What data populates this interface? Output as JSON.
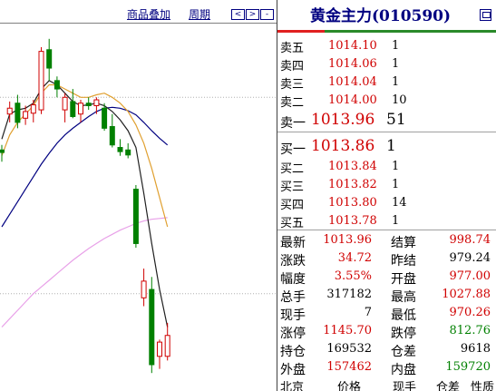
{
  "chart_toolbar": {
    "overlay_label": "商品叠加",
    "period_label": "周期",
    "btn_left": "<",
    "btn_right": ">",
    "btn_zoom": "-"
  },
  "quote": {
    "title": "黄金主力(010590)",
    "asks": [
      {
        "label": "卖五",
        "price": "1014.10",
        "vol": "1"
      },
      {
        "label": "卖四",
        "price": "1014.06",
        "vol": "1"
      },
      {
        "label": "卖三",
        "price": "1014.04",
        "vol": "1"
      },
      {
        "label": "卖二",
        "price": "1014.00",
        "vol": "10"
      },
      {
        "label": "卖一",
        "price": "1013.96",
        "vol": "51"
      }
    ],
    "bids": [
      {
        "label": "买一",
        "price": "1013.86",
        "vol": "1"
      },
      {
        "label": "买二",
        "price": "1013.84",
        "vol": "1"
      },
      {
        "label": "买三",
        "price": "1013.82",
        "vol": "1"
      },
      {
        "label": "买四",
        "price": "1013.80",
        "vol": "14"
      },
      {
        "label": "买五",
        "price": "1013.78",
        "vol": "1"
      }
    ],
    "stats": [
      {
        "l1": "最新",
        "v1": "1013.96",
        "c1": "red",
        "l2": "结算",
        "v2": "998.74",
        "c2": "red"
      },
      {
        "l1": "涨跌",
        "v1": "34.72",
        "c1": "red",
        "l2": "昨结",
        "v2": "979.24",
        "c2": "black"
      },
      {
        "l1": "幅度",
        "v1": "3.55%",
        "c1": "red",
        "l2": "开盘",
        "v2": "977.00",
        "c2": "red"
      },
      {
        "l1": "总手",
        "v1": "317182",
        "c1": "black",
        "l2": "最高",
        "v2": "1027.88",
        "c2": "red"
      },
      {
        "l1": "现手",
        "v1": "7",
        "c1": "black",
        "l2": "最低",
        "v2": "970.26",
        "c2": "red"
      },
      {
        "l1": "涨停",
        "v1": "1145.70",
        "c1": "red",
        "l2": "跌停",
        "v2": "812.76",
        "c2": "green"
      },
      {
        "l1": "持仓",
        "v1": "169532",
        "c1": "black",
        "l2": "仓差",
        "v2": "9618",
        "c2": "black"
      },
      {
        "l1": "外盘",
        "v1": "157462",
        "c1": "red",
        "l2": "内盘",
        "v2": "159720",
        "c2": "green"
      }
    ],
    "footer": {
      "col1": "北京",
      "col2": "价格",
      "col3": "现手",
      "col4": "仓差",
      "col5": "性质"
    }
  },
  "colors": {
    "up": "#d00000",
    "down": "#008000",
    "title": "#000080"
  },
  "chart_data": {
    "type": "candlestick",
    "candles": [
      {
        "o": 1.2,
        "h": 1.8,
        "l": -0.2,
        "c": 0.9,
        "up": false
      },
      {
        "o": 5.5,
        "h": 7.0,
        "l": 4.5,
        "c": 6.2,
        "up": true
      },
      {
        "o": 6.8,
        "h": 7.8,
        "l": 3.8,
        "c": 4.5,
        "up": false
      },
      {
        "o": 5.0,
        "h": 6.5,
        "l": 4.2,
        "c": 5.8,
        "up": true
      },
      {
        "o": 5.6,
        "h": 7.2,
        "l": 4.5,
        "c": 6.6,
        "up": true
      },
      {
        "o": 6.0,
        "h": 13.5,
        "l": 5.5,
        "c": 13.0,
        "up": true
      },
      {
        "o": 13.2,
        "h": 14.5,
        "l": 9.5,
        "c": 11.0,
        "up": false
      },
      {
        "o": 9.5,
        "h": 10.0,
        "l": 7.5,
        "c": 8.5,
        "up": false
      },
      {
        "o": 6.0,
        "h": 8.0,
        "l": 4.5,
        "c": 7.5,
        "up": true
      },
      {
        "o": 7.0,
        "h": 8.5,
        "l": 5.0,
        "c": 5.2,
        "up": false
      },
      {
        "o": 5.5,
        "h": 7.2,
        "l": 4.5,
        "c": 6.8,
        "up": true
      },
      {
        "o": 6.8,
        "h": 7.5,
        "l": 6.0,
        "c": 6.5,
        "up": false
      },
      {
        "o": 6.5,
        "h": 7.5,
        "l": 5.5,
        "c": 7.2,
        "up": true
      },
      {
        "o": 6.2,
        "h": 6.8,
        "l": 3.5,
        "c": 3.8,
        "up": false
      },
      {
        "o": 4.0,
        "h": 5.5,
        "l": 1.5,
        "c": 1.8,
        "up": false
      },
      {
        "o": 1.5,
        "h": 2.5,
        "l": 0.5,
        "c": 1.0,
        "up": false
      },
      {
        "o": 1.2,
        "h": 2.0,
        "l": 0.2,
        "c": 0.6,
        "up": false
      },
      {
        "o": -3.5,
        "h": -3.0,
        "l": -10.5,
        "c": -10.0,
        "up": false
      },
      {
        "o": -14.5,
        "h": -13.0,
        "l": -17.5,
        "c": -16.5,
        "up": true
      },
      {
        "o": -15.5,
        "h": -14.0,
        "l": -25.5,
        "c": -24.5,
        "up": false
      },
      {
        "o": -23.5,
        "h": -21.5,
        "l": -25.0,
        "c": -21.8,
        "up": true
      },
      {
        "o": -21.0,
        "h": -19.5,
        "l": -24.0,
        "c": -23.5,
        "up": true
      }
    ],
    "ma_white": [
      2.5,
      5.5,
      6.0,
      6.2,
      6.8,
      8.5,
      9.5,
      9.0,
      8.0,
      7.0,
      6.5,
      6.6,
      6.8,
      6.5,
      5.8,
      4.8,
      3.5,
      1.5,
      -4.0,
      -10.0,
      -15.5,
      -20.0
    ],
    "ma_yellow": [
      0.5,
      3.0,
      4.5,
      5.5,
      6.5,
      8.0,
      9.0,
      9.0,
      8.5,
      8.0,
      7.5,
      7.5,
      7.8,
      8.0,
      7.5,
      6.8,
      5.8,
      4.2,
      2.0,
      -1.0,
      -4.5,
      -8.0
    ],
    "ma_blue": [
      -8.0,
      -6.5,
      -5.0,
      -3.5,
      -2.0,
      -0.5,
      0.8,
      2.0,
      3.0,
      3.8,
      4.5,
      5.2,
      5.8,
      6.2,
      6.3,
      6.2,
      5.9,
      5.4,
      4.5,
      3.5,
      2.6,
      1.8
    ],
    "ma_pink": [
      -20.0,
      -19.0,
      -18.0,
      -17.0,
      -16.0,
      -15.2,
      -14.4,
      -13.6,
      -12.8,
      -12.0,
      -11.3,
      -10.6,
      -10.0,
      -9.4,
      -8.9,
      -8.4,
      -8.0,
      -7.6,
      -7.3,
      -7.1,
      -7.0,
      -6.9
    ],
    "ylim": [
      -27,
      16
    ],
    "grid_lines": [
      7.5,
      -16
    ]
  }
}
